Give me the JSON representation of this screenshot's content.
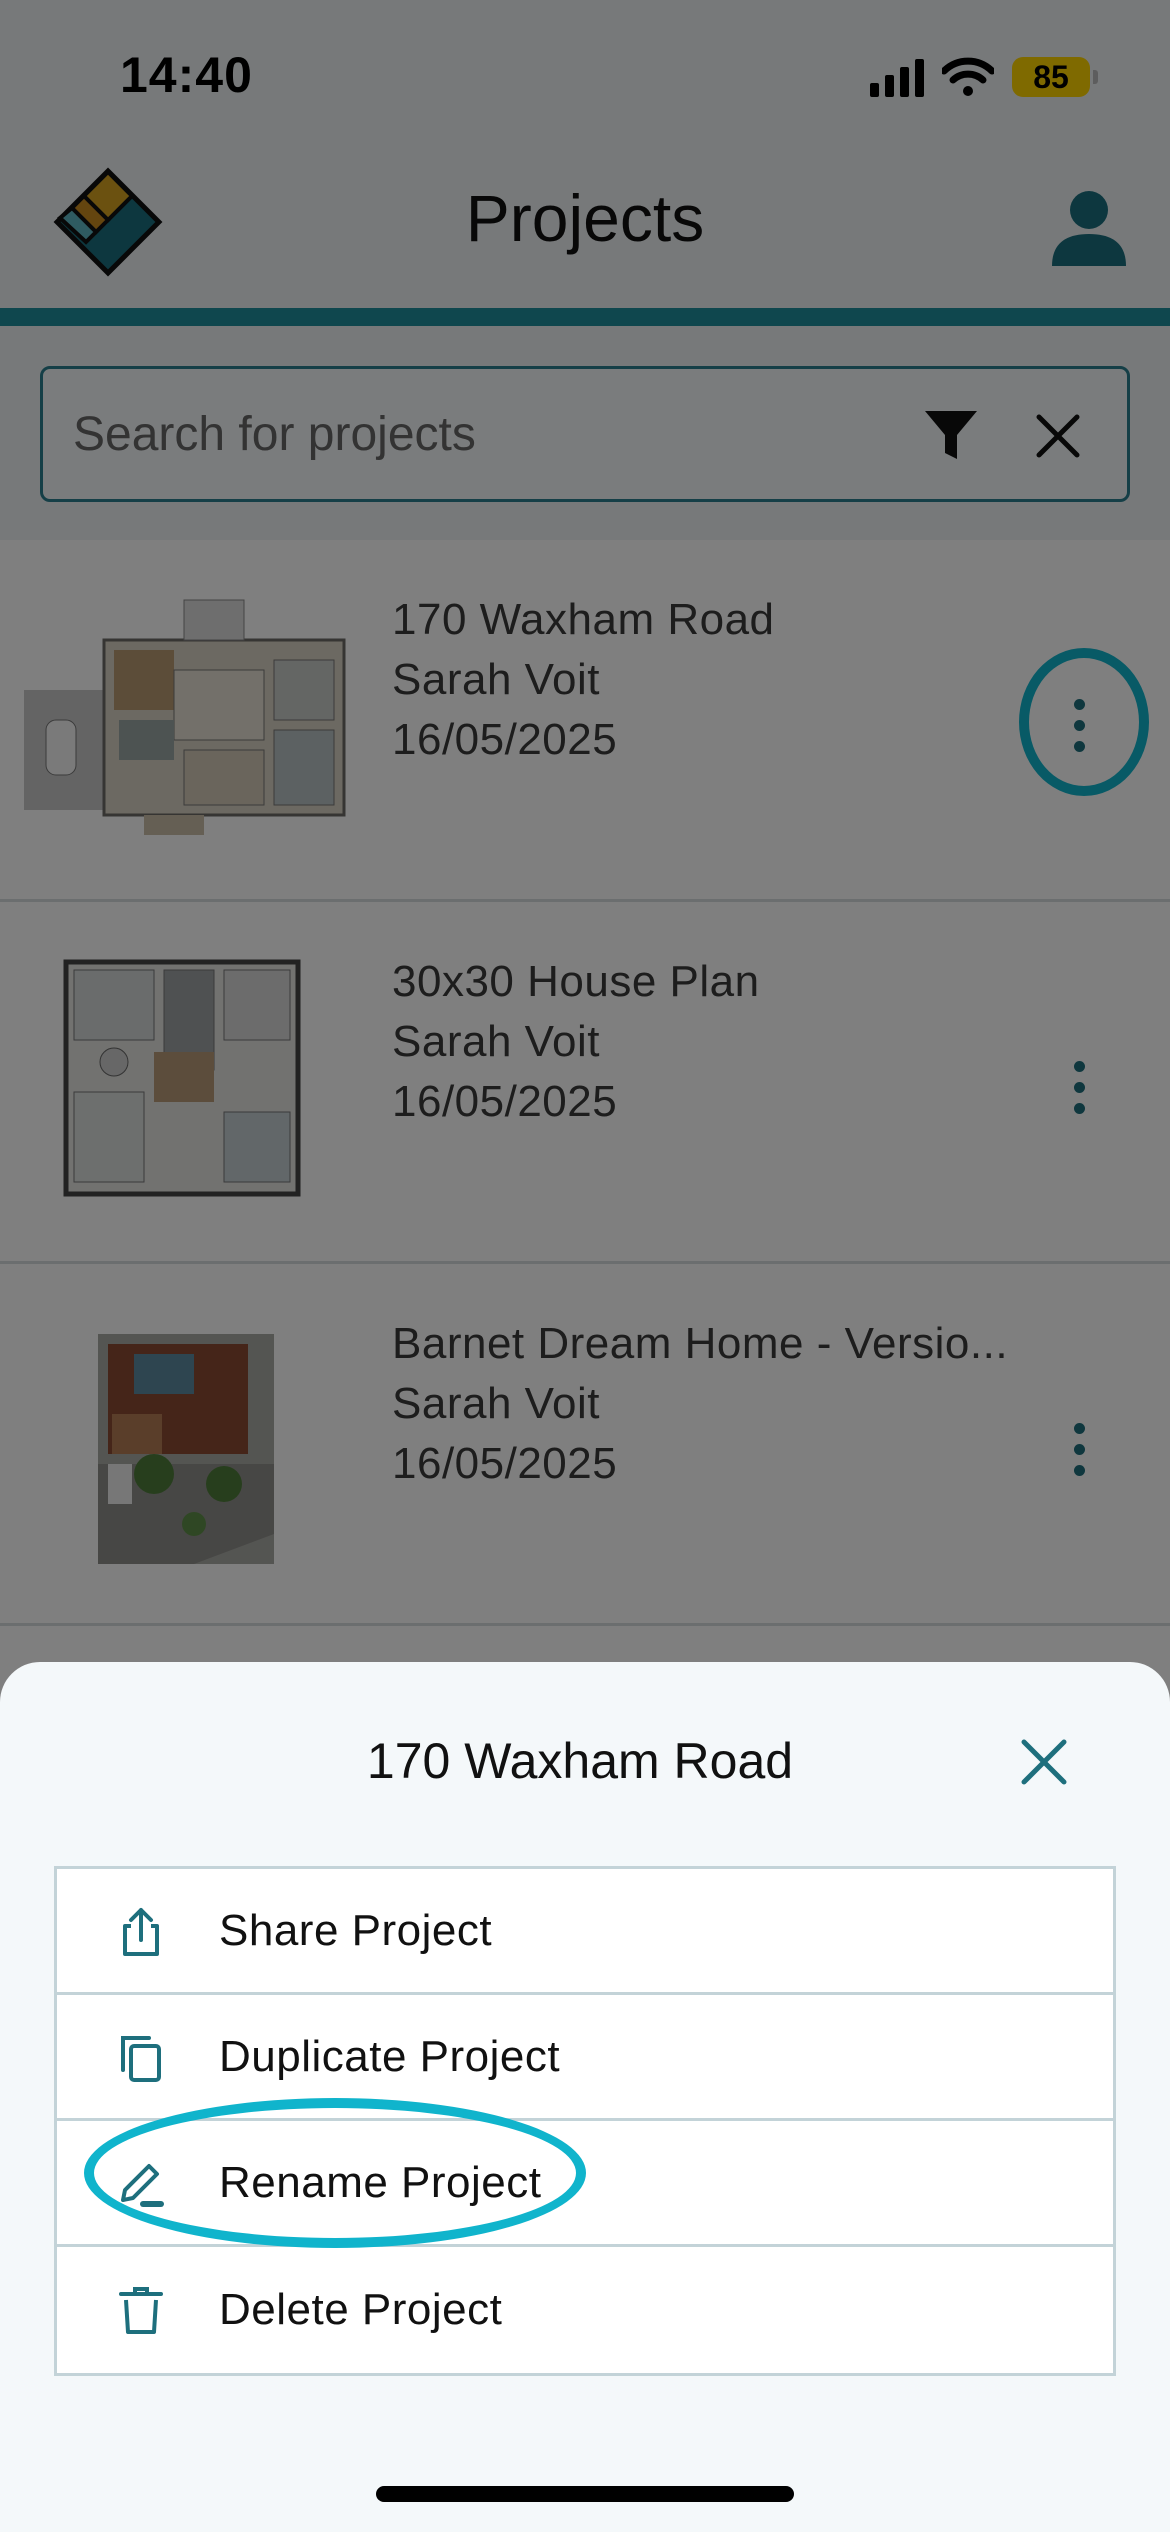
{
  "status_bar": {
    "time": "14:40",
    "battery": "85"
  },
  "header": {
    "title": "Projects"
  },
  "search": {
    "placeholder": "Search for projects"
  },
  "projects": [
    {
      "name": "170 Waxham Road",
      "owner": "Sarah Voit",
      "date": "16/05/2025"
    },
    {
      "name": "30x30 House Plan",
      "owner": "Sarah Voit",
      "date": "16/05/2025"
    },
    {
      "name": "Barnet Dream Home - Versio...",
      "owner": "Sarah Voit",
      "date": "16/05/2025"
    }
  ],
  "sheet": {
    "title": "170 Waxham Road",
    "items": [
      {
        "label": "Share Project",
        "icon": "share-icon"
      },
      {
        "label": "Duplicate Project",
        "icon": "duplicate-icon"
      },
      {
        "label": "Rename Project",
        "icon": "edit-pencil-icon"
      },
      {
        "label": "Delete Project",
        "icon": "trash-icon"
      }
    ]
  },
  "colors": {
    "accent": "#1e8e9c",
    "highlight": "#10b4cc",
    "icon": "#1e6f7d",
    "battery": "#ffd400"
  }
}
